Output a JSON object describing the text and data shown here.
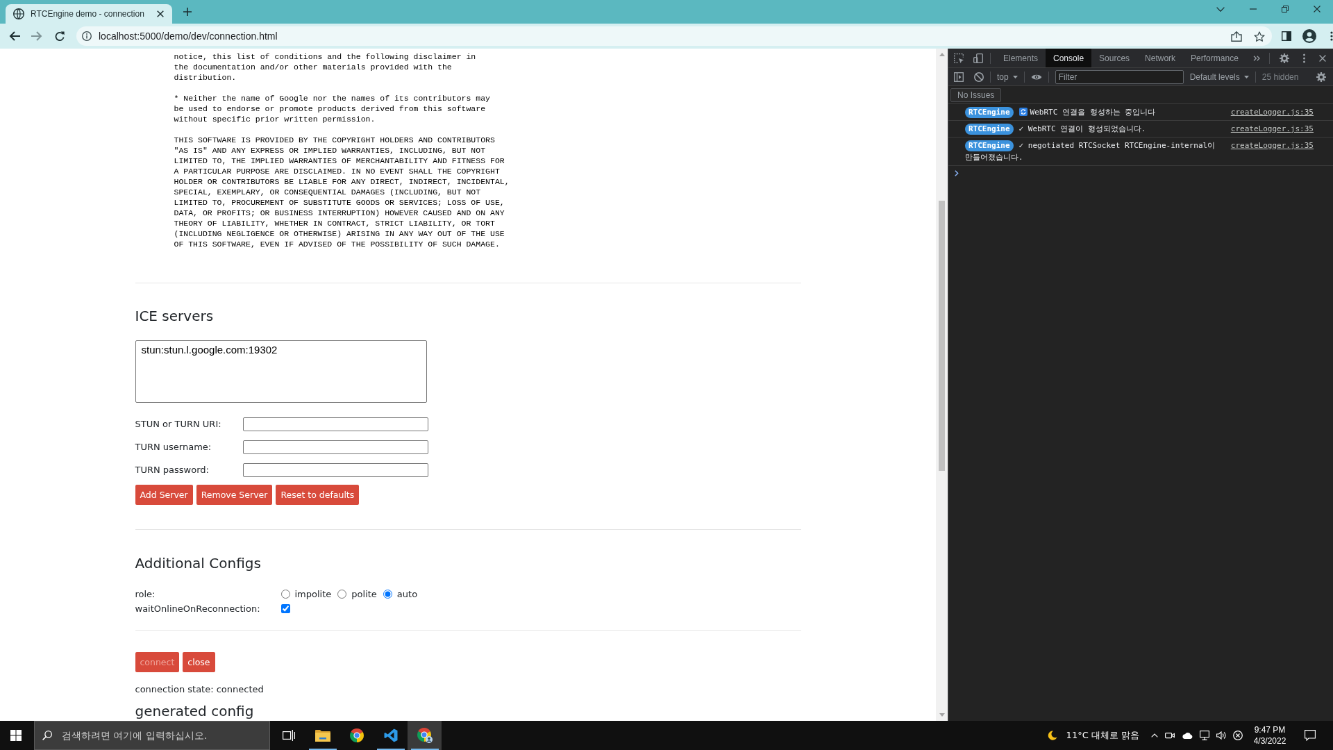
{
  "browser": {
    "tab": {
      "title": "RTCEngine demo - connection"
    },
    "address_bar": {
      "value": "localhost:5000/demo/dev/connection.html"
    }
  },
  "page": {
    "license_paragraphs": [
      "notice, this list of conditions and the following disclaimer in\nthe documentation and/or other materials provided with the\ndistribution.",
      "* Neither the name of Google nor the names of its contributors may\nbe used to endorse or promote products derived from this software\nwithout specific prior written permission.",
      "THIS SOFTWARE IS PROVIDED BY THE COPYRIGHT HOLDERS AND CONTRIBUTORS\n\"AS IS\" AND ANY EXPRESS OR IMPLIED WARRANTIES, INCLUDING, BUT NOT\nLIMITED TO, THE IMPLIED WARRANTIES OF MERCHANTABILITY AND FITNESS FOR\nA PARTICULAR PURPOSE ARE DISCLAIMED. IN NO EVENT SHALL THE COPYRIGHT\nHOLDER OR CONTRIBUTORS BE LIABLE FOR ANY DIRECT, INDIRECT, INCIDENTAL,\nSPECIAL, EXEMPLARY, OR CONSEQUENTIAL DAMAGES (INCLUDING, BUT NOT\nLIMITED TO, PROCUREMENT OF SUBSTITUTE GOODS OR SERVICES; LOSS OF USE,\nDATA, OR PROFITS; OR BUSINESS INTERRUPTION) HOWEVER CAUSED AND ON ANY\nTHEORY OF LIABILITY, WHETHER IN CONTRACT, STRICT LIABILITY, OR TORT\n(INCLUDING NEGLIGENCE OR OTHERWISE) ARISING IN ANY WAY OUT OF THE USE\nOF THIS SOFTWARE, EVEN IF ADVISED OF THE POSSIBILITY OF SUCH DAMAGE."
    ],
    "ice_servers": {
      "heading": "ICE servers",
      "servers": {
        "value": "stun:stun.l.google.com:19302"
      },
      "fields": [
        {
          "label": "STUN or TURN URI:"
        },
        {
          "label": "TURN username:"
        },
        {
          "label": "TURN password:"
        }
      ],
      "buttons": [
        {
          "label": "Add Server"
        },
        {
          "label": "Remove Server"
        },
        {
          "label": "Reset to defaults"
        }
      ]
    },
    "additional_configs": {
      "heading": "Additional Configs",
      "role": {
        "label": "role:",
        "options": [
          {
            "label": "impolite",
            "selected": false
          },
          {
            "label": "polite",
            "selected": false
          },
          {
            "label": "auto",
            "selected": true
          }
        ]
      },
      "wait_online": {
        "label": "waitOnlineOnReconnection:",
        "checked": true
      }
    },
    "connection": {
      "buttons": [
        {
          "label": "connect",
          "disabled": true
        },
        {
          "label": "close",
          "disabled": false
        }
      ],
      "state": "connection state: connected"
    },
    "generated_config": {
      "heading": "generated config"
    }
  },
  "devtools": {
    "tabs": [
      {
        "label": "Elements",
        "selected": false
      },
      {
        "label": "Console",
        "selected": true
      },
      {
        "label": "Sources",
        "selected": false
      },
      {
        "label": "Network",
        "selected": false
      },
      {
        "label": "Performance",
        "selected": false
      }
    ],
    "toolbar": {
      "context": "top",
      "filter": {
        "placeholder": "Filter"
      },
      "levels": "Default levels",
      "hidden": "25 hidden"
    },
    "issues": "No Issues",
    "messages": [
      {
        "kind": "progress",
        "badge": "RTCEngine",
        "text": "WebRTC 연결을 형성하는 중입니다",
        "source": "createLogger.js:35"
      },
      {
        "kind": "plain",
        "badge": "RTCEngine",
        "text": "✓ WebRTC 연결이 형성되었습니다.",
        "source": "createLogger.js:35"
      },
      {
        "kind": "plain",
        "badge": "RTCEngine",
        "text": "✓ negotiated RTCSocket RTCEngine-internal이 만들어졌습니다.",
        "source": "createLogger.js:35"
      }
    ]
  },
  "taskbar": {
    "search": {
      "placeholder": "검색하려면 여기에 입력하십시오."
    },
    "apps": [
      {
        "kind": "task_view",
        "running": false,
        "selected": false
      },
      {
        "kind": "folder",
        "running": true,
        "selected": false
      },
      {
        "kind": "browser",
        "running": false,
        "selected": false
      },
      {
        "kind": "code_editor",
        "running": true,
        "selected": false
      },
      {
        "kind": "browser_profile",
        "running": true,
        "selected": true
      }
    ],
    "weather": "11°C 대체로 맑음",
    "clock": {
      "time": "9:47 PM",
      "date": "4/3/2022"
    }
  }
}
